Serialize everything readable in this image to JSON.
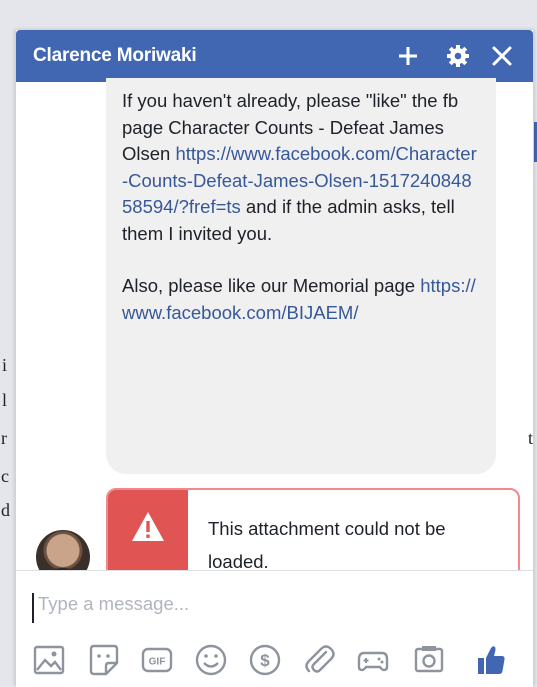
{
  "chat": {
    "contact_name": "Clarence Moriwaki",
    "header_icons": [
      "plus-icon",
      "gear-icon",
      "close-icon"
    ],
    "colors": {
      "header": "#4267b2",
      "link": "#365899",
      "error": "#e05454",
      "like": "#4267b2"
    }
  },
  "message": {
    "line1": "If you haven't already, please \"like\" the fb page Character Counts - Defeat James Olsen ",
    "link1": "https://www.facebook.com/Character-Counts-Defeat-James-Olsen-151724084858594/?fref=ts",
    "line2": " and if the admin asks, tell them I invited you.",
    "line3": "Also, please like our Memorial page ",
    "link2": "https://www.facebook.com/BIJAEM/"
  },
  "error": {
    "text": "This attachment could not be loaded.",
    "icon": "warning-icon"
  },
  "composer": {
    "placeholder": "Type a message...",
    "tools": [
      "photo-icon",
      "sticker-icon",
      "gif-icon",
      "emoji-icon",
      "payment-icon",
      "attachment-icon",
      "game-icon",
      "camera-icon",
      "like-icon"
    ]
  }
}
